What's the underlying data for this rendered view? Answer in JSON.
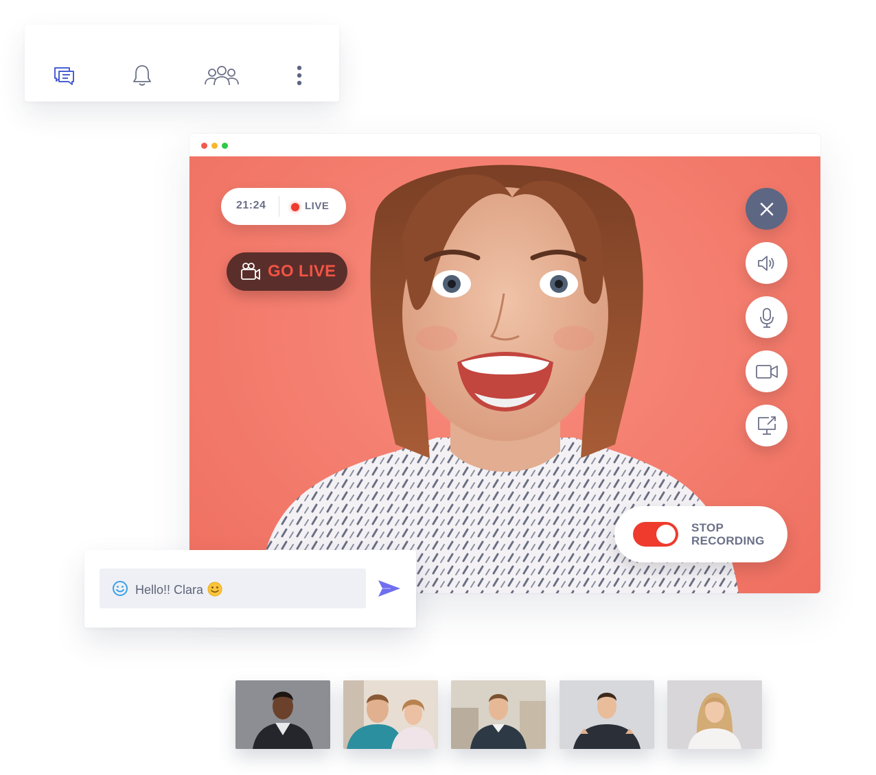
{
  "toolbar": {
    "icons": [
      "chat-icon",
      "bell-icon",
      "people-icon",
      "more-vertical-icon"
    ],
    "accent": "#4a5fd3"
  },
  "window": {
    "traffic_lights": [
      "#f15a4c",
      "#f5b82e",
      "#2ec94a"
    ]
  },
  "call": {
    "timer": "21:24",
    "live_label": "LIVE",
    "go_live_label": "GO LIVE",
    "stop_recording_label": "STOP RECORDING",
    "recording_on": true,
    "controls": [
      "close-icon",
      "speaker-icon",
      "microphone-icon",
      "video-camera-icon",
      "screen-share-icon"
    ]
  },
  "chat": {
    "message": "Hello!! Clara",
    "send_icon": "send-icon"
  },
  "participants": [
    {
      "name_hint": "participant-1"
    },
    {
      "name_hint": "participant-2"
    },
    {
      "name_hint": "participant-3"
    },
    {
      "name_hint": "participant-4"
    },
    {
      "name_hint": "participant-5"
    }
  ],
  "colors": {
    "stage_background": "#f47f70",
    "live_red": "#ee3b2e",
    "go_live_bg": "#5a2e2a",
    "go_live_text": "#f25345",
    "control_dark": "#5d6683",
    "text_gray": "#6b7088",
    "send_purple": "#6f6ef0"
  }
}
